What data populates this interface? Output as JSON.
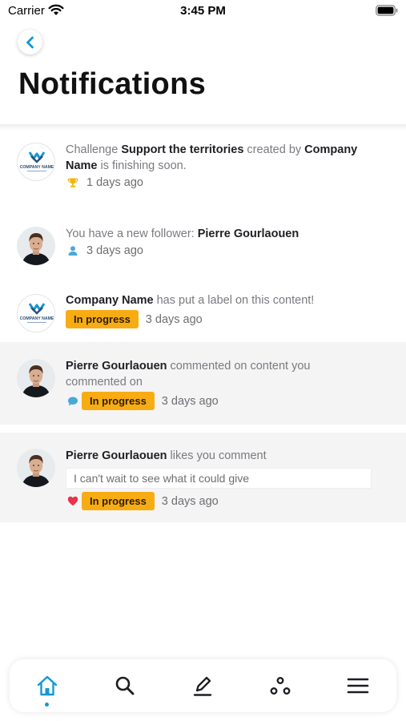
{
  "status_bar": {
    "carrier": "Carrier",
    "time": "3:45 PM"
  },
  "header": {
    "title": "Notifications"
  },
  "notifications": [
    {
      "avatar": "company-logo",
      "avatar_text": "COMPANY NAME",
      "parts": [
        "Challenge ",
        "Support the territories",
        " created by ",
        "Company Name",
        " is finishing soon."
      ],
      "icon": "trophy-icon",
      "time": "1 days ago"
    },
    {
      "avatar": "user-photo",
      "parts": [
        "You have a new follower: ",
        "Pierre Gourlaouen"
      ],
      "icon": "person-icon",
      "time": "3 days ago"
    },
    {
      "avatar": "company-logo",
      "avatar_text": "COMPANY NAME",
      "parts": [
        "Company Name",
        " has put a label on this content!"
      ],
      "tag": "In progress",
      "time": "3 days ago"
    },
    {
      "avatar": "user-photo",
      "parts": [
        "Pierre Gourlaouen",
        " commented on content you commented on"
      ],
      "icon": "comment-icon",
      "tag": "In progress",
      "time": "3 days ago"
    },
    {
      "avatar": "user-photo",
      "parts": [
        "Pierre Gourlaouen",
        " likes you comment"
      ],
      "quote": "I can't wait to see what it could give",
      "icon": "heart-icon",
      "tag": "In progress",
      "time": "3 days ago"
    }
  ],
  "tab_bar": {
    "items": [
      "home-icon",
      "search-icon",
      "edit-icon",
      "network-icon",
      "menu-icon"
    ],
    "active": "home-icon"
  },
  "colors": {
    "accent": "#1597d5",
    "tag": "#f8ac13",
    "unread_bg": "#f4f4f5",
    "heart": "#e8344a"
  }
}
